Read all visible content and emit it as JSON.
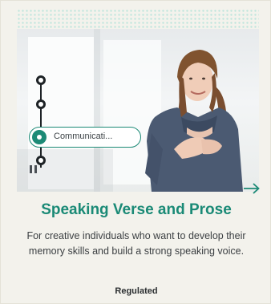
{
  "course": {
    "title": "Speaking Verse and Prose",
    "description": "For creative individuals who want to develop their memory skills and build a strong speaking voice.",
    "badge": "Regulated"
  },
  "timeline": {
    "active_label": "Communicati...",
    "steps": 4,
    "active_index": 2
  },
  "icons": {
    "arrow": "arrow-right-icon"
  },
  "colors": {
    "accent": "#1c8a76",
    "background": "#f3f2ec",
    "text": "#3b3f42"
  }
}
